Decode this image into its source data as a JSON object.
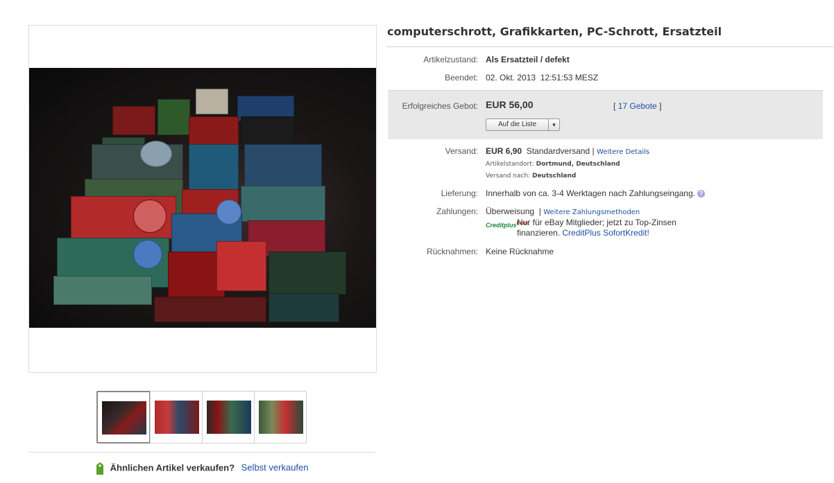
{
  "listing": {
    "title": "computerschrott, Grafikkarten, PC-Schrott, Ersatzteil"
  },
  "details": {
    "condition_label": "Artikelzustand:",
    "condition_value": "Als Ersatzteil / defekt",
    "ended_label": "Beendet:",
    "ended_value": "02. Okt. 2013",
    "ended_time": "12:51:53 MESZ"
  },
  "bid": {
    "label": "Erfolgreiches Gebot:",
    "price": "EUR 56,00",
    "bids_open": "[",
    "bids_link": "17 Gebote",
    "bids_close": "]",
    "watch_button": "Auf die Liste",
    "watch_arrow": "▾"
  },
  "shipping": {
    "label": "Versand:",
    "price": "EUR 6,90",
    "method": "Standardversand",
    "sep": "|",
    "details_link": "Weitere Details",
    "location_label": "Artikelstandort:",
    "location_value": "Dortmund, Deutschland",
    "to_label": "Versand nach:",
    "to_value": "Deutschland"
  },
  "delivery": {
    "label": "Lieferung:",
    "value": "Innerhalb von ca. 3-4 Werktagen nach Zahlungseingang.",
    "help_icon": "?"
  },
  "payment": {
    "label": "Zahlungen:",
    "method": "Überweisung",
    "sep": "|",
    "more_link": "Weitere Zahlungsmethoden",
    "credit_logo": "Creditplus",
    "credit_logo_bank": "BANK",
    "credit_text_1": "Nur für eBay Mitglieder; jetzt zu Top-Zinsen",
    "credit_text_2": "finanzieren.",
    "credit_link": "CreditPlus SofortKredit!"
  },
  "returns": {
    "label": "Rücknahmen:",
    "value": "Keine Rücknahme"
  },
  "sell": {
    "question": "Ähnlichen Artikel verkaufen?",
    "link": "Selbst verkaufen"
  },
  "colors": {
    "link": "#1e4fa3",
    "bid_box": "#e8e8e8"
  }
}
